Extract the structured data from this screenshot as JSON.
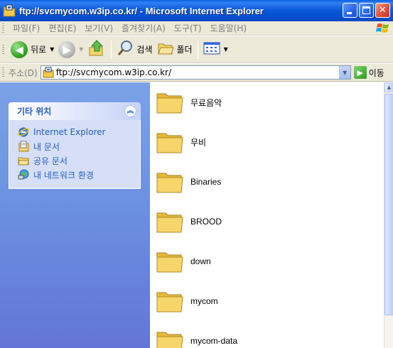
{
  "window": {
    "title": "ftp://svcmycom.w3ip.co.kr/ - Microsoft Internet Explorer",
    "minimize_glyph": "",
    "close_glyph": "✕"
  },
  "menu": {
    "items": [
      "파일(F)",
      "편집(E)",
      "보기(V)",
      "즐겨찾기(A)",
      "도구(T)",
      "도움말(H)"
    ]
  },
  "toolbar": {
    "back_label": "뒤로",
    "search_label": "검색",
    "folders_label": "폴더"
  },
  "address": {
    "label": "주소(D)",
    "value": "ftp://svcmycom.w3ip.co.kr/",
    "go_label": "이동"
  },
  "task_pane": {
    "title": "기타 위치",
    "links": [
      {
        "label": "Internet Explorer",
        "icon": "ie-icon"
      },
      {
        "label": "내 문서",
        "icon": "my-documents-icon"
      },
      {
        "label": "공유 문서",
        "icon": "shared-documents-icon"
      },
      {
        "label": "내 네트워크 환경",
        "icon": "network-places-icon"
      }
    ]
  },
  "files": [
    {
      "name": "무료음악",
      "type": "folder"
    },
    {
      "name": "무비",
      "type": "folder"
    },
    {
      "name": "Binaries",
      "type": "folder"
    },
    {
      "name": "BROOD",
      "type": "folder"
    },
    {
      "name": "down",
      "type": "folder"
    },
    {
      "name": "mycom",
      "type": "folder"
    },
    {
      "name": "mycom-data",
      "type": "folder"
    }
  ],
  "colors": {
    "titlebar": "#0957d8",
    "chrome": "#ece9d8",
    "task_pane": "#6b8fe0",
    "link": "#215dc6",
    "folder": "#f6d66b"
  }
}
